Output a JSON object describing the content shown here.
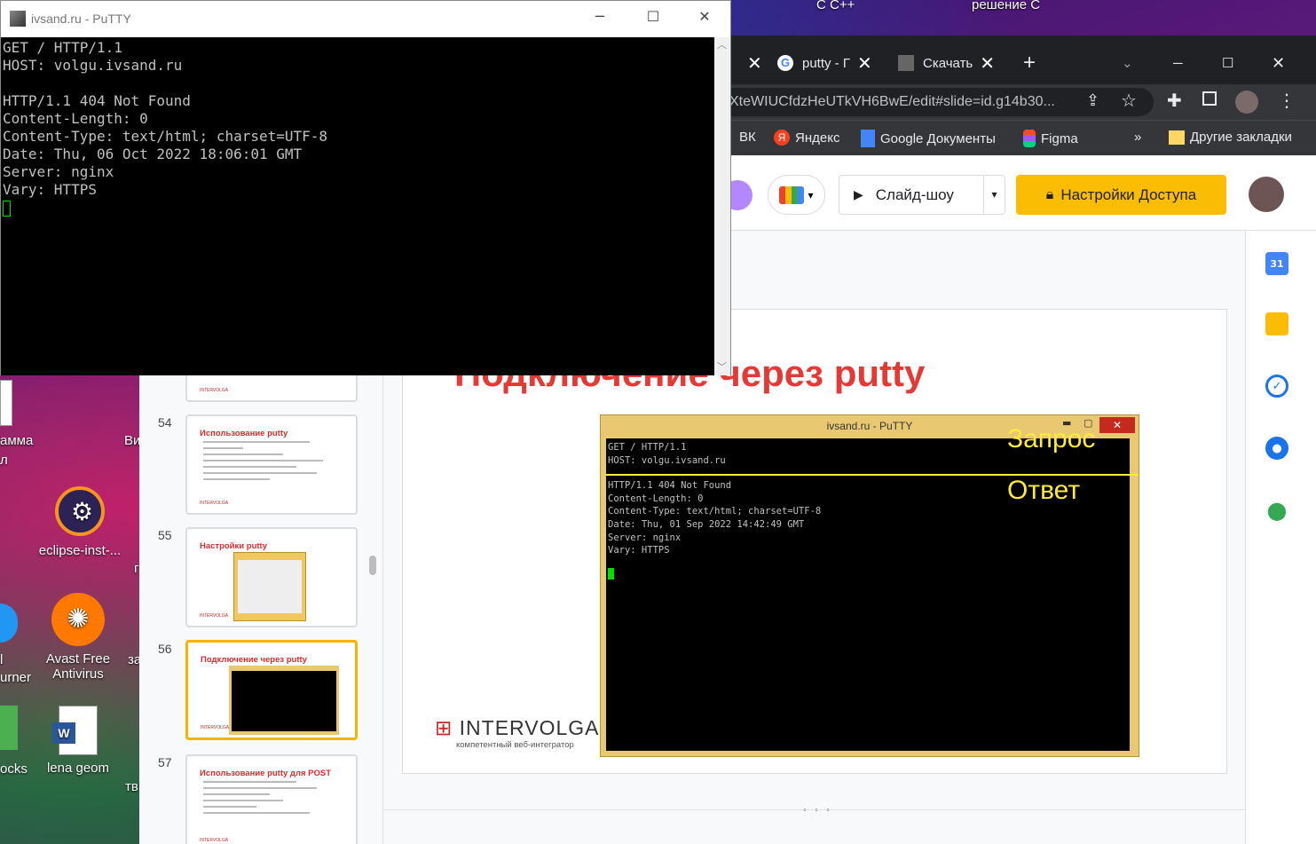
{
  "desktop": {
    "icons": [
      {
        "label": "eclipse-inst-..."
      },
      {
        "label": "Avast Free Antivirus"
      },
      {
        "label": "lena geom"
      }
    ],
    "fragments": [
      "C C++",
      "решение С",
      "амма",
      "л",
      "Ви",
      "l",
      "urner",
      "за",
      "ocks",
      "тв",
      "г"
    ]
  },
  "putty": {
    "title": "ivsand.ru - PuTTY",
    "terminal": "GET / HTTP/1.1\nHOST: volgu.ivsand.ru\n\nHTTP/1.1 404 Not Found\nContent-Length: 0\nContent-Type: text/html; charset=UTF-8\nDate: Thu, 06 Oct 2022 18:06:01 GMT\nServer: nginx\nVary: HTTPS\n"
  },
  "chrome": {
    "tabs": [
      {
        "label": "putty - Г"
      },
      {
        "label": "Скачать"
      }
    ],
    "url": "XteWIUCfdzHeUTkVH6BwE/edit#slide=id.g14b30...",
    "bookmarks": [
      "ВК",
      "Яндекс",
      "Google Документы",
      "Figma",
      "»",
      "Другие закладки"
    ]
  },
  "slides": {
    "toolbar": {
      "slideshow": "Слайд-шоу",
      "access": "Настройки Доступа"
    },
    "filmstrip": [
      {
        "num": "54",
        "title": "Использование putty"
      },
      {
        "num": "55",
        "title": "Настройки putty"
      },
      {
        "num": "56",
        "title": "Подключение через putty"
      },
      {
        "num": "57",
        "title": "Использование putty для POST"
      }
    ],
    "current": {
      "title": "Подключение через putty",
      "brand_name": "INTERVOLGA",
      "brand_sub": "компетентный веб-интегратор",
      "shot_title": "ivsand.ru - PuTTY",
      "shot_request": "GET / HTTP/1.1\nHOST: volgu.ivsand.ru",
      "shot_response": "HTTP/1.1 404 Not Found\nContent-Length: 0\nContent-Type: text/html; charset=UTF-8\nDate: Thu, 01 Sep 2022 14:42:49 GMT\nServer: nginx\nVary: HTTPS",
      "label_request": "Запрос",
      "label_response": "Ответ"
    },
    "rail_calendar_day": "31"
  }
}
